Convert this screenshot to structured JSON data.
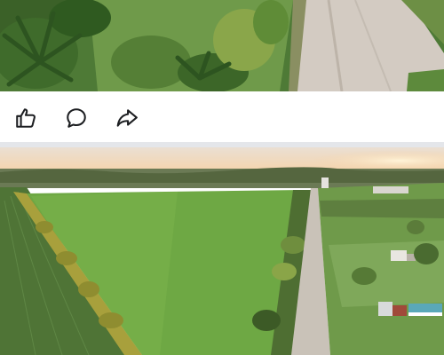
{
  "feed": {
    "posts": [
      {
        "image": "aerial-road-vegetation-photo"
      },
      {
        "image": "aerial-field-sunset-photo"
      }
    ],
    "actions": [
      {
        "icon": "thumbs-up-icon"
      },
      {
        "icon": "comment-icon"
      },
      {
        "icon": "share-icon"
      }
    ]
  },
  "colors": {
    "icon": "#1c1e21",
    "divider": "#e4e6ea",
    "field": "#5f9a3a",
    "sky": "#f3dcc2",
    "road": "#c9c2b8"
  }
}
